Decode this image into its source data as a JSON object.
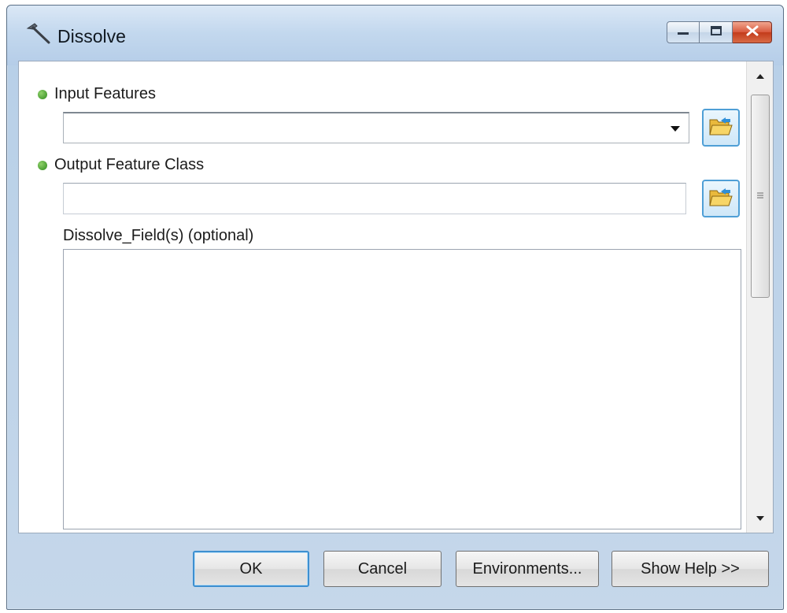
{
  "window": {
    "title": "Dissolve",
    "title_icon": "hammer-icon",
    "caption_buttons": [
      "minimize-icon",
      "maximize-icon",
      "close-icon"
    ]
  },
  "form": {
    "input_features": {
      "label": "Input Features",
      "required": true,
      "value": "",
      "control": "combo-box",
      "browse_icon": "open-folder-icon"
    },
    "output_feature_class": {
      "label": "Output Feature Class",
      "required": true,
      "value": "",
      "browse_icon": "open-folder-icon"
    },
    "dissolve_fields": {
      "label": "Dissolve_Field(s) (optional)",
      "items": []
    }
  },
  "buttons": {
    "ok": "OK",
    "cancel": "Cancel",
    "environments": "Environments...",
    "show_help": "Show Help >>"
  },
  "colors": {
    "required_bullet": "#3a9a25",
    "default_button_border": "#3d8fd0",
    "close_button": "#c8452a"
  }
}
